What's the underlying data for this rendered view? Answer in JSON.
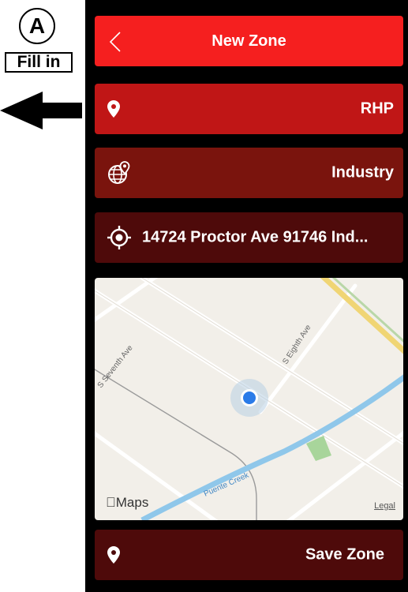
{
  "annotation": {
    "letter": "A",
    "label": "Fill in"
  },
  "header": {
    "title": "New Zone"
  },
  "form": {
    "zone_name": "RHP",
    "category": "Industry",
    "address": "14724 Proctor Ave 91746 Ind..."
  },
  "map": {
    "streets": {
      "seventh": "S Seventh Ave",
      "eighth": "S Eighth Ave",
      "creek": "Puente Creek"
    },
    "attribution": "Maps",
    "legal": "Legal"
  },
  "footer": {
    "save_label": "Save Zone"
  },
  "colors": {
    "header": "#f51f1f",
    "name_row": "#c01616",
    "category_row": "#7a140d",
    "address_row": "#4e0a0a",
    "save_row": "#4e0a0a",
    "location_dot": "#2a7be8"
  }
}
